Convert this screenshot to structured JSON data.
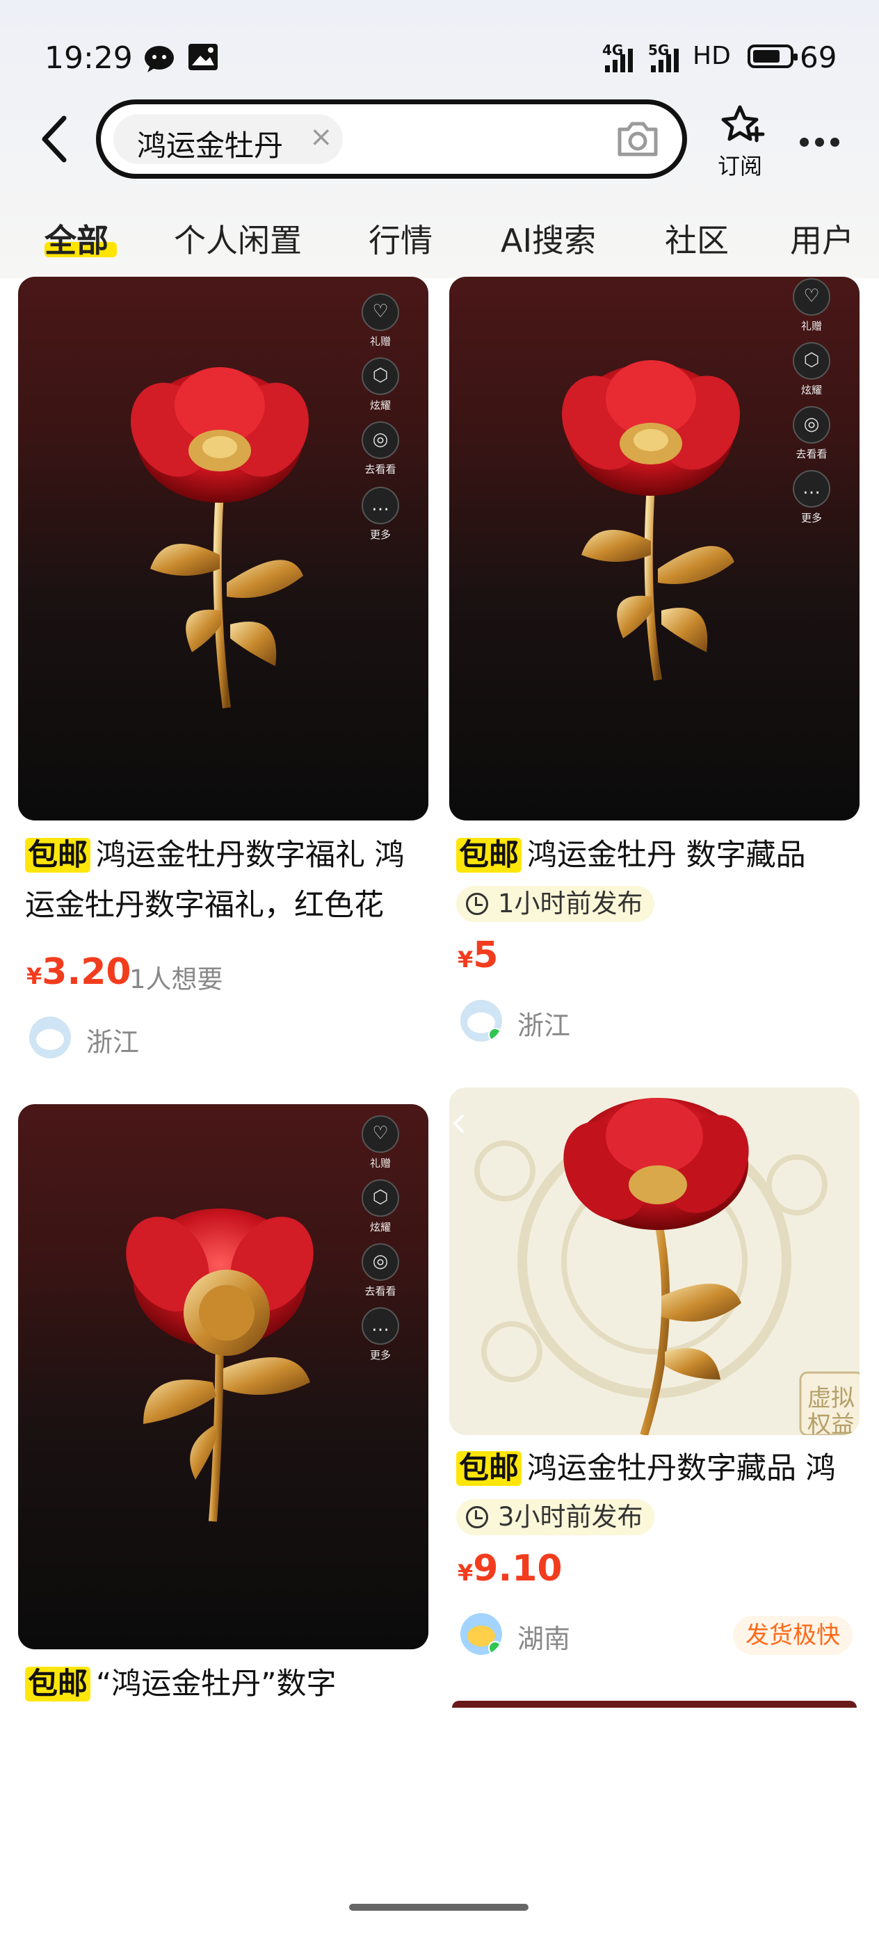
{
  "status_bar": {
    "time": "19:29",
    "net1": "4G",
    "net2": "5G",
    "hd": "HD",
    "battery": "69"
  },
  "search": {
    "query": "鸿运金牡丹",
    "clear": "×",
    "subscribe_label": "订阅"
  },
  "tabs": [
    {
      "label": "全部",
      "active": true
    },
    {
      "label": "个人闲置"
    },
    {
      "label": "行情"
    },
    {
      "label": "AI搜索"
    },
    {
      "label": "社区"
    },
    {
      "label": "用户"
    }
  ],
  "side_icons": [
    "礼赠",
    "炫耀",
    "去看看",
    "更多"
  ],
  "products": [
    {
      "tag": "包邮",
      "title": "鸿运金牡丹数字福礼 鸿运金牡丹数字福礼，红色花",
      "currency": "¥",
      "price": "3.20",
      "want": "1人想要",
      "location": "浙江"
    },
    {
      "tag": "包邮",
      "title": "鸿运金牡丹 数字藏品",
      "posted": "1小时前发布",
      "currency": "¥",
      "price": "5",
      "location": "浙江"
    },
    {
      "tag": "包邮",
      "title": "“鸿运金牡丹”数字"
    },
    {
      "tag": "包邮",
      "title": "鸿运金牡丹数字藏品 鸿",
      "posted": "3小时前发布",
      "currency": "¥",
      "price": "9.10",
      "location": "湖南",
      "badge": "发货极快",
      "watermark": "虚拟权益"
    }
  ],
  "colors": {
    "price": "#f23c1e",
    "tag_bg": "#ffe60a",
    "fast_text": "#ff6a1a"
  }
}
